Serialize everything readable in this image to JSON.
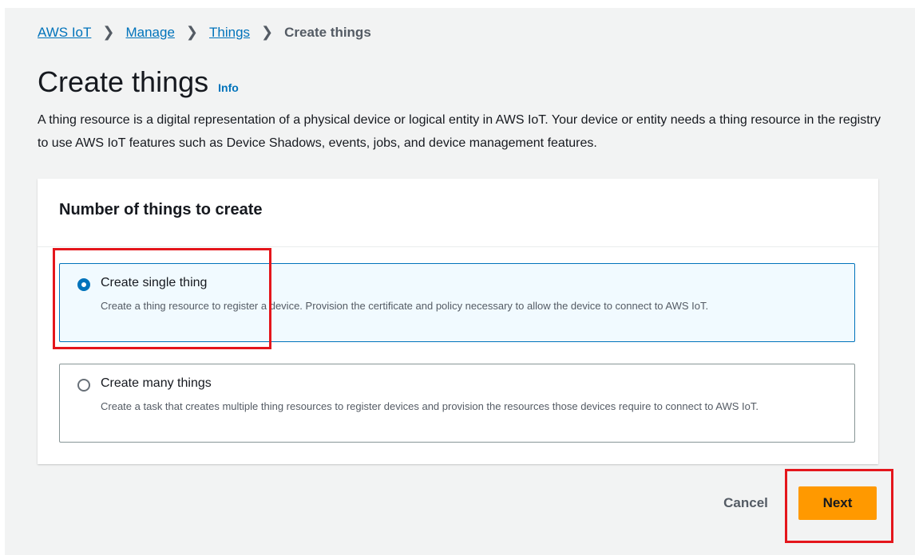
{
  "breadcrumb": {
    "items": [
      {
        "label": "AWS IoT"
      },
      {
        "label": "Manage"
      },
      {
        "label": "Things"
      }
    ],
    "current": "Create things",
    "separator": ">"
  },
  "header": {
    "title": "Create things",
    "info_label": "Info",
    "description": "A thing resource is a digital representation of a physical device or logical entity in AWS IoT. Your device or entity needs a thing resource in the registry to use AWS IoT features such as Device Shadows, events, jobs, and device management features."
  },
  "panel": {
    "title": "Number of things to create",
    "options": [
      {
        "label": "Create single thing",
        "description": "Create a thing resource to register a device. Provision the certificate and policy necessary to allow the device to connect to AWS IoT.",
        "selected": true
      },
      {
        "label": "Create many things",
        "description": "Create a task that creates multiple thing resources to register devices and provision the resources those devices require to connect to AWS IoT.",
        "selected": false
      }
    ]
  },
  "actions": {
    "cancel_label": "Cancel",
    "next_label": "Next"
  },
  "colors": {
    "link": "#0073bb",
    "primary_button": "#ff9900",
    "selected_tile_bg": "#f1faff",
    "annotation_highlight": "#e4161c"
  }
}
